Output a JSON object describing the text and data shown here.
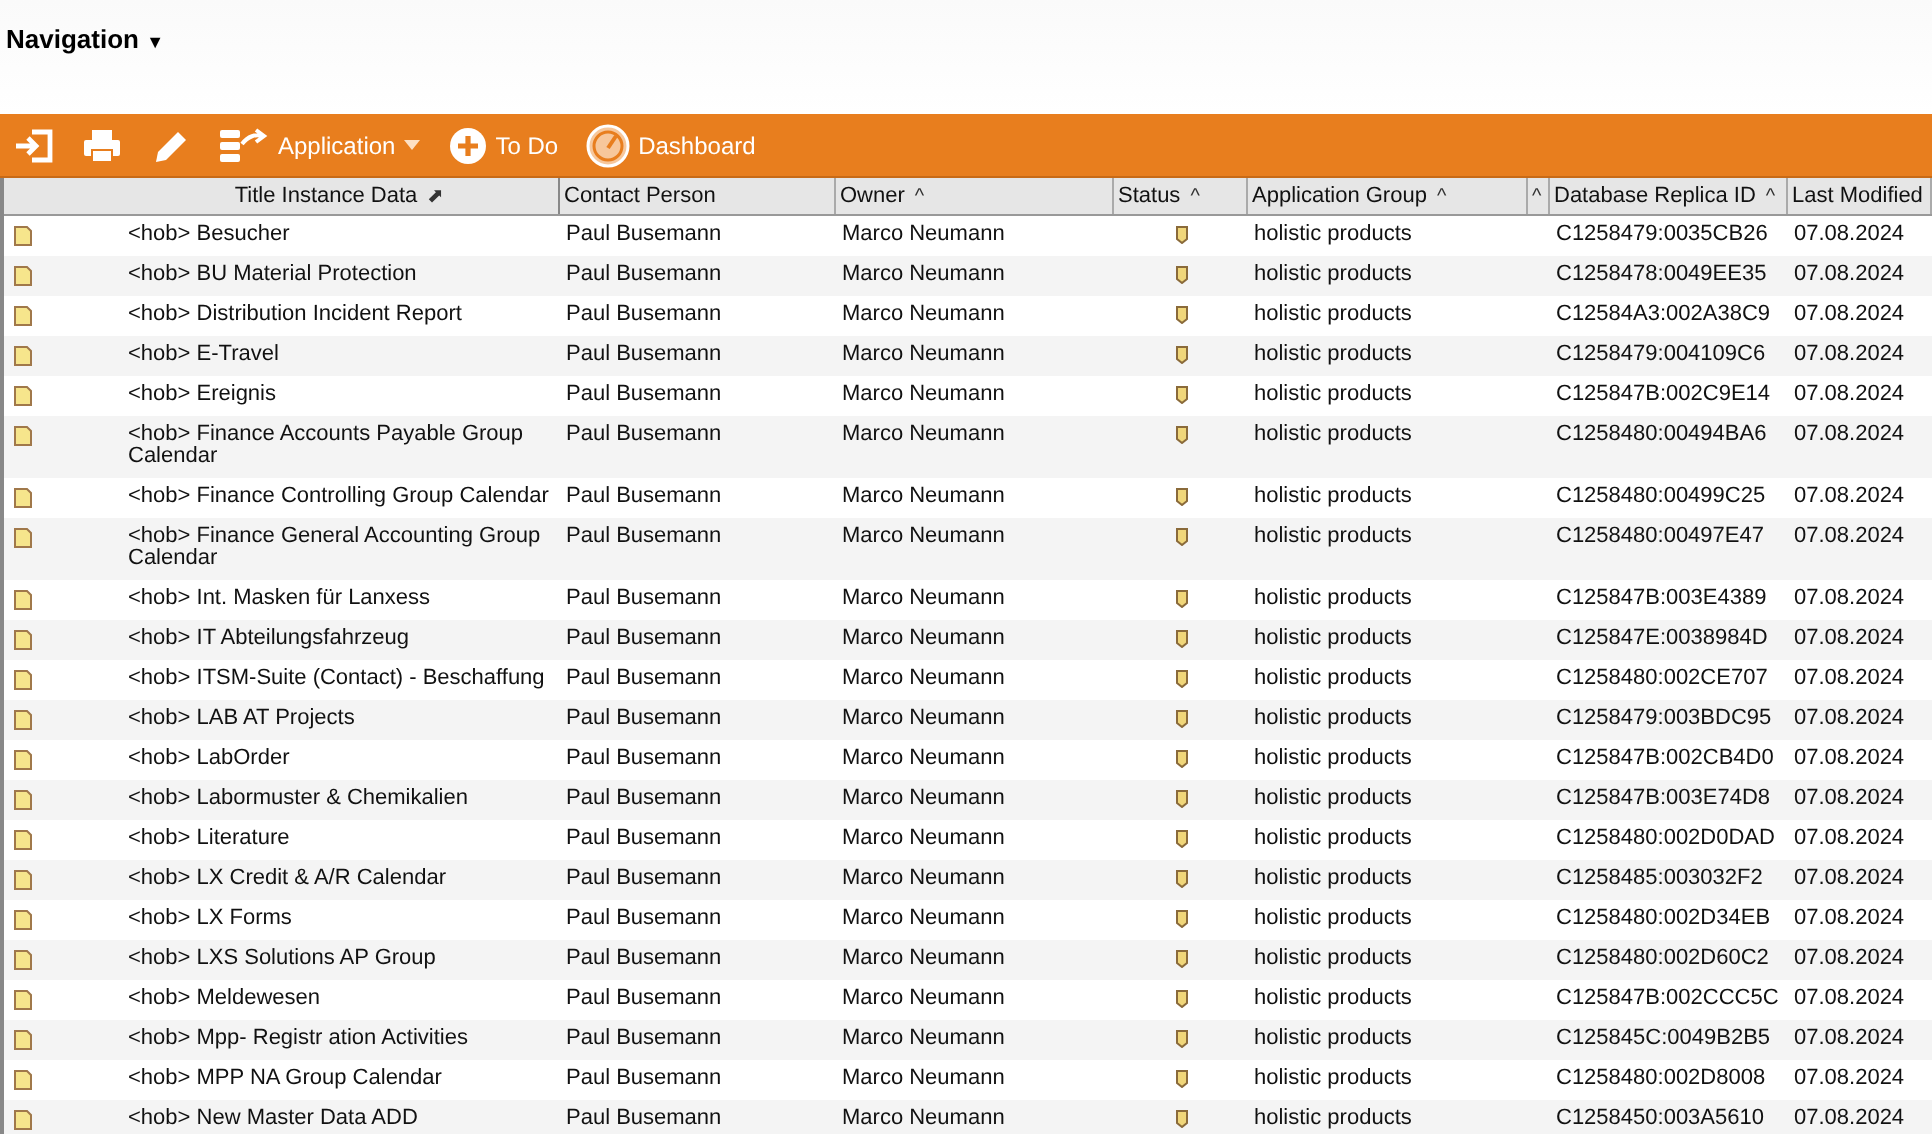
{
  "navigation": {
    "label": "Navigation",
    "caret": "▼"
  },
  "toolbar": [
    {
      "kind": "signin"
    },
    {
      "kind": "print"
    },
    {
      "kind": "edit"
    },
    {
      "kind": "database",
      "label": "Application",
      "dropdown": true
    },
    {
      "kind": "plus",
      "label": "To Do"
    },
    {
      "kind": "gauge",
      "label": "Dashboard"
    }
  ],
  "table": {
    "columns": [
      {
        "label": "Title Instance Data",
        "sort_mark": "⬈"
      },
      {
        "label": "Contact Person"
      },
      {
        "label": "Owner",
        "sort_mark": "^"
      },
      {
        "label": "Status",
        "sort_mark": "^"
      },
      {
        "label": "Application Group",
        "sort_mark": "^"
      },
      {
        "sort_mark": "^"
      },
      {
        "label": "Database Replica ID",
        "sort_mark": "^"
      },
      {
        "label": "Last Modified"
      }
    ],
    "rows": [
      {
        "title": "<hob> Besucher",
        "contact": "Paul Busemann",
        "owner": "Marco Neumann",
        "group": "holistic products",
        "replica": "C1258479:0035CB26",
        "modified": "07.08.2024"
      },
      {
        "title": "<hob> BU Material Protection",
        "contact": "Paul Busemann",
        "owner": "Marco Neumann",
        "group": "holistic products",
        "replica": "C1258478:0049EE35",
        "modified": "07.08.2024"
      },
      {
        "title": "<hob> Distribution Incident Report",
        "contact": "Paul Busemann",
        "owner": "Marco Neumann",
        "group": "holistic products",
        "replica": "C12584A3:002A38C9",
        "modified": "07.08.2024"
      },
      {
        "title": "<hob> E-Travel",
        "contact": "Paul Busemann",
        "owner": "Marco Neumann",
        "group": "holistic products",
        "replica": "C1258479:004109C6",
        "modified": "07.08.2024"
      },
      {
        "title": "<hob> Ereignis",
        "contact": "Paul Busemann",
        "owner": "Marco Neumann",
        "group": "holistic products",
        "replica": "C125847B:002C9E14",
        "modified": "07.08.2024"
      },
      {
        "title": "<hob> Finance Accounts Payable Group Calendar",
        "contact": "Paul Busemann",
        "owner": "Marco Neumann",
        "group": "holistic products",
        "replica": "C1258480:00494BA6",
        "modified": "07.08.2024"
      },
      {
        "title": "<hob> Finance Controlling Group Calendar",
        "contact": "Paul Busemann",
        "owner": "Marco Neumann",
        "group": "holistic products",
        "replica": "C1258480:00499C25",
        "modified": "07.08.2024"
      },
      {
        "title": "<hob> Finance General Accounting Group Calendar",
        "contact": "Paul Busemann",
        "owner": "Marco Neumann",
        "group": "holistic products",
        "replica": "C1258480:00497E47",
        "modified": "07.08.2024"
      },
      {
        "title": "<hob> Int. Masken für Lanxess",
        "contact": "Paul Busemann",
        "owner": "Marco Neumann",
        "group": "holistic products",
        "replica": "C125847B:003E4389",
        "modified": "07.08.2024"
      },
      {
        "title": "<hob> IT Abteilungsfahrzeug",
        "contact": "Paul Busemann",
        "owner": "Marco Neumann",
        "group": "holistic products",
        "replica": "C125847E:0038984D",
        "modified": "07.08.2024"
      },
      {
        "title": "<hob> ITSM-Suite (Contact) - Beschaffung",
        "contact": "Paul Busemann",
        "owner": "Marco Neumann",
        "group": "holistic products",
        "replica": "C1258480:002CE707",
        "modified": "07.08.2024"
      },
      {
        "title": "<hob> LAB AT Projects",
        "contact": "Paul Busemann",
        "owner": "Marco Neumann",
        "group": "holistic products",
        "replica": "C1258479:003BDC95",
        "modified": "07.08.2024"
      },
      {
        "title": "<hob> LabOrder",
        "contact": "Paul Busemann",
        "owner": "Marco Neumann",
        "group": "holistic products",
        "replica": "C125847B:002CB4D0",
        "modified": "07.08.2024"
      },
      {
        "title": "<hob> Labormuster & Chemikalien",
        "contact": "Paul Busemann",
        "owner": "Marco Neumann",
        "group": "holistic products",
        "replica": "C125847B:003E74D8",
        "modified": "07.08.2024"
      },
      {
        "title": "<hob> Literature",
        "contact": "Paul Busemann",
        "owner": "Marco Neumann",
        "group": "holistic products",
        "replica": "C1258480:002D0DAD",
        "modified": "07.08.2024"
      },
      {
        "title": "<hob> LX Credit & A/R Calendar",
        "contact": "Paul Busemann",
        "owner": "Marco Neumann",
        "group": "holistic products",
        "replica": "C1258485:003032F2",
        "modified": "07.08.2024"
      },
      {
        "title": "<hob> LX Forms",
        "contact": "Paul Busemann",
        "owner": "Marco Neumann",
        "group": "holistic products",
        "replica": "C1258480:002D34EB",
        "modified": "07.08.2024"
      },
      {
        "title": "<hob> LXS Solutions AP Group",
        "contact": "Paul Busemann",
        "owner": "Marco Neumann",
        "group": "holistic products",
        "replica": "C1258480:002D60C2",
        "modified": "07.08.2024"
      },
      {
        "title": "<hob> Meldewesen",
        "contact": "Paul Busemann",
        "owner": "Marco Neumann",
        "group": "holistic products",
        "replica": "C125847B:002CCC5C",
        "modified": "07.08.2024"
      },
      {
        "title": "<hob> Mpp- Registr ation Activities",
        "contact": "Paul Busemann",
        "owner": "Marco Neumann",
        "group": "holistic products",
        "replica": "C125845C:0049B2B5",
        "modified": "07.08.2024"
      },
      {
        "title": "<hob> MPP NA Group Calendar",
        "contact": "Paul Busemann",
        "owner": "Marco Neumann",
        "group": "holistic products",
        "replica": "C1258480:002D8008",
        "modified": "07.08.2024"
      },
      {
        "title": "<hob> New Master Data ADD",
        "contact": "Paul Busemann",
        "owner": "Marco Neumann",
        "group": "holistic products",
        "replica": "C1258450:003A5610",
        "modified": "07.08.2024"
      }
    ]
  }
}
